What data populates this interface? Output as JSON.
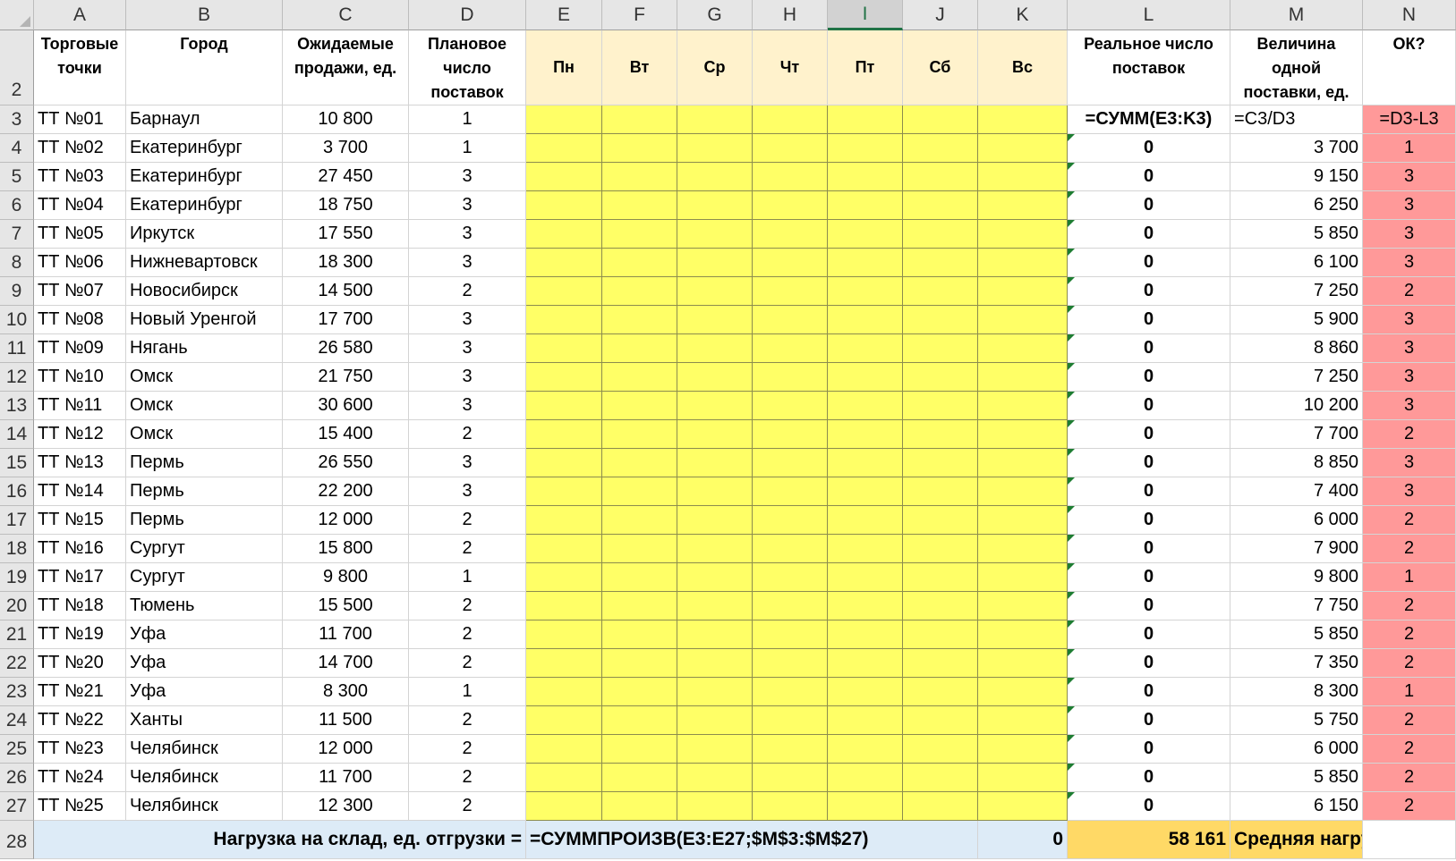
{
  "columns": [
    "A",
    "B",
    "C",
    "D",
    "E",
    "F",
    "G",
    "H",
    "I",
    "J",
    "K",
    "L",
    "M",
    "N"
  ],
  "active_column": "I",
  "header": {
    "row_number": "2",
    "trade_points": "Торговые точки",
    "city": "Город",
    "expected_sales": "Ожидаемые продажи, ед.",
    "planned_deliveries": "Плановое число поставок",
    "days": [
      "Пн",
      "Вт",
      "Ср",
      "Чт",
      "Пт",
      "Сб",
      "Вс"
    ],
    "real_deliveries": "Реальное число поставок",
    "delivery_size": "Величина одной поставки, ед.",
    "ok": "ОК?"
  },
  "rows": [
    {
      "n": "3",
      "tt": "ТТ №01",
      "city": "Барнаул",
      "sales": "10 800",
      "plan": "1",
      "real": "=СУММ(E3:K3)",
      "size": "=C3/D3",
      "ok": "=D3-L3"
    },
    {
      "n": "4",
      "tt": "ТТ №02",
      "city": "Екатеринбург",
      "sales": "3 700",
      "plan": "1",
      "real": "0",
      "size": "3 700",
      "ok": "1"
    },
    {
      "n": "5",
      "tt": "ТТ №03",
      "city": "Екатеринбург",
      "sales": "27 450",
      "plan": "3",
      "real": "0",
      "size": "9 150",
      "ok": "3"
    },
    {
      "n": "6",
      "tt": "ТТ №04",
      "city": "Екатеринбург",
      "sales": "18 750",
      "plan": "3",
      "real": "0",
      "size": "6 250",
      "ok": "3"
    },
    {
      "n": "7",
      "tt": "ТТ №05",
      "city": "Иркутск",
      "sales": "17 550",
      "plan": "3",
      "real": "0",
      "size": "5 850",
      "ok": "3"
    },
    {
      "n": "8",
      "tt": "ТТ №06",
      "city": "Нижневартовск",
      "sales": "18 300",
      "plan": "3",
      "real": "0",
      "size": "6 100",
      "ok": "3"
    },
    {
      "n": "9",
      "tt": "ТТ №07",
      "city": "Новосибирск",
      "sales": "14 500",
      "plan": "2",
      "real": "0",
      "size": "7 250",
      "ok": "2"
    },
    {
      "n": "10",
      "tt": "ТТ №08",
      "city": "Новый Уренгой",
      "sales": "17 700",
      "plan": "3",
      "real": "0",
      "size": "5 900",
      "ok": "3"
    },
    {
      "n": "11",
      "tt": "ТТ №09",
      "city": "Нягань",
      "sales": "26 580",
      "plan": "3",
      "real": "0",
      "size": "8 860",
      "ok": "3"
    },
    {
      "n": "12",
      "tt": "ТТ №10",
      "city": "Омск",
      "sales": "21 750",
      "plan": "3",
      "real": "0",
      "size": "7 250",
      "ok": "3"
    },
    {
      "n": "13",
      "tt": "ТТ №11",
      "city": "Омск",
      "sales": "30 600",
      "plan": "3",
      "real": "0",
      "size": "10 200",
      "ok": "3"
    },
    {
      "n": "14",
      "tt": "ТТ №12",
      "city": "Омск",
      "sales": "15 400",
      "plan": "2",
      "real": "0",
      "size": "7 700",
      "ok": "2"
    },
    {
      "n": "15",
      "tt": "ТТ №13",
      "city": "Пермь",
      "sales": "26 550",
      "plan": "3",
      "real": "0",
      "size": "8 850",
      "ok": "3"
    },
    {
      "n": "16",
      "tt": "ТТ №14",
      "city": "Пермь",
      "sales": "22 200",
      "plan": "3",
      "real": "0",
      "size": "7 400",
      "ok": "3"
    },
    {
      "n": "17",
      "tt": "ТТ №15",
      "city": "Пермь",
      "sales": "12 000",
      "plan": "2",
      "real": "0",
      "size": "6 000",
      "ok": "2"
    },
    {
      "n": "18",
      "tt": "ТТ №16",
      "city": "Сургут",
      "sales": "15 800",
      "plan": "2",
      "real": "0",
      "size": "7 900",
      "ok": "2"
    },
    {
      "n": "19",
      "tt": "ТТ №17",
      "city": "Сургут",
      "sales": "9 800",
      "plan": "1",
      "real": "0",
      "size": "9 800",
      "ok": "1"
    },
    {
      "n": "20",
      "tt": "ТТ №18",
      "city": "Тюмень",
      "sales": "15 500",
      "plan": "2",
      "real": "0",
      "size": "7 750",
      "ok": "2"
    },
    {
      "n": "21",
      "tt": "ТТ №19",
      "city": "Уфа",
      "sales": "11 700",
      "plan": "2",
      "real": "0",
      "size": "5 850",
      "ok": "2"
    },
    {
      "n": "22",
      "tt": "ТТ №20",
      "city": "Уфа",
      "sales": "14 700",
      "plan": "2",
      "real": "0",
      "size": "7 350",
      "ok": "2"
    },
    {
      "n": "23",
      "tt": "ТТ №21",
      "city": "Уфа",
      "sales": "8 300",
      "plan": "1",
      "real": "0",
      "size": "8 300",
      "ok": "1"
    },
    {
      "n": "24",
      "tt": "ТТ №22",
      "city": "Ханты",
      "sales": "11 500",
      "plan": "2",
      "real": "0",
      "size": "5 750",
      "ok": "2"
    },
    {
      "n": "25",
      "tt": "ТТ №23",
      "city": "Челябинск",
      "sales": "12 000",
      "plan": "2",
      "real": "0",
      "size": "6 000",
      "ok": "2"
    },
    {
      "n": "26",
      "tt": "ТТ №24",
      "city": "Челябинск",
      "sales": "11 700",
      "plan": "2",
      "real": "0",
      "size": "5 850",
      "ok": "2"
    },
    {
      "n": "27",
      "tt": "ТТ №25",
      "city": "Челябинск",
      "sales": "12 300",
      "plan": "2",
      "real": "0",
      "size": "6 150",
      "ok": "2"
    }
  ],
  "footer": {
    "row_number": "28",
    "label": "Нагрузка на склад, ед. отгрузки =",
    "formula": "=СУММПРОИЗВ(E3:E27;$M$3:$M$27)",
    "k_value": "0",
    "average_value": "58 161",
    "average_label": "Средняя нагрузка"
  },
  "colors": {
    "yellow_cells": "#ffff66",
    "day_header": "#fff2cc",
    "ok_column": "#ff9999",
    "footer_label": "#ddebf7",
    "footer_average": "#ffd966"
  }
}
